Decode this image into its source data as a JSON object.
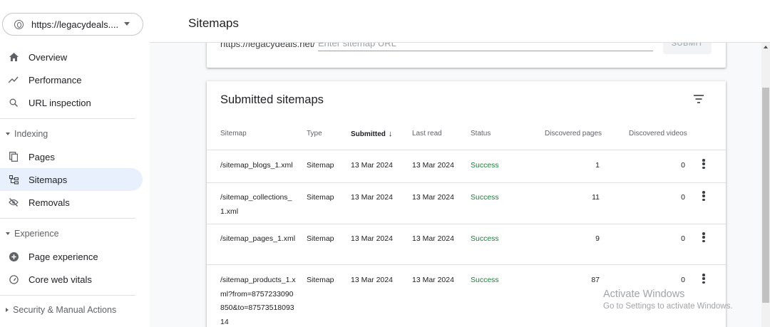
{
  "property": {
    "url": "https://legacydeals...."
  },
  "nav": {
    "top": [
      {
        "label": "Overview",
        "icon": "home-icon"
      },
      {
        "label": "Performance",
        "icon": "trending-up-icon"
      },
      {
        "label": "URL inspection",
        "icon": "search-icon"
      }
    ],
    "indexing": {
      "label": "Indexing",
      "items": [
        {
          "label": "Pages",
          "icon": "pages-icon"
        },
        {
          "label": "Sitemaps",
          "icon": "sitemap-icon",
          "active": true
        },
        {
          "label": "Removals",
          "icon": "eye-off-icon"
        }
      ]
    },
    "experience": {
      "label": "Experience",
      "items": [
        {
          "label": "Page experience",
          "icon": "plus-circle-icon"
        },
        {
          "label": "Core web vitals",
          "icon": "gauge-icon"
        }
      ]
    },
    "security": {
      "label": "Security & Manual Actions"
    }
  },
  "header": {
    "title": "Sitemaps"
  },
  "add_sitemap": {
    "url_prefix": "https://legacydeals.net/",
    "placeholder": "Enter sitemap URL",
    "submit_label": "SUBMIT"
  },
  "submitted": {
    "title": "Submitted sitemaps",
    "columns": {
      "sitemap": "Sitemap",
      "type": "Type",
      "submitted": "Submitted",
      "last_read": "Last read",
      "status": "Status",
      "discovered_pages": "Discovered pages",
      "discovered_videos": "Discovered videos"
    },
    "rows": [
      {
        "sitemap": "/sitemap_blogs_1.xml",
        "type": "Sitemap",
        "submitted": "13 Mar 2024",
        "last_read": "13 Mar 2024",
        "status": "Success",
        "pages": "1",
        "videos": "0"
      },
      {
        "sitemap": "/sitemap_collections_1.xml",
        "type": "Sitemap",
        "submitted": "13 Mar 2024",
        "last_read": "13 Mar 2024",
        "status": "Success",
        "pages": "11",
        "videos": "0"
      },
      {
        "sitemap": "/sitemap_pages_1.xml",
        "type": "Sitemap",
        "submitted": "13 Mar 2024",
        "last_read": "13 Mar 2024",
        "status": "Success",
        "pages": "9",
        "videos": "0"
      },
      {
        "sitemap": "/sitemap_products_1.xml?from=8757233090850&to=8757351809314",
        "type": "Sitemap",
        "submitted": "13 Mar 2024",
        "last_read": "13 Mar 2024",
        "status": "Success",
        "pages": "87",
        "videos": "0"
      }
    ]
  },
  "watermark": {
    "title": "Activate Windows",
    "subtitle": "Go to Settings to activate Windows."
  },
  "colors": {
    "active_nav_bg": "#e8f0fe",
    "success": "#188038",
    "content_bg": "#f8f9fa"
  }
}
